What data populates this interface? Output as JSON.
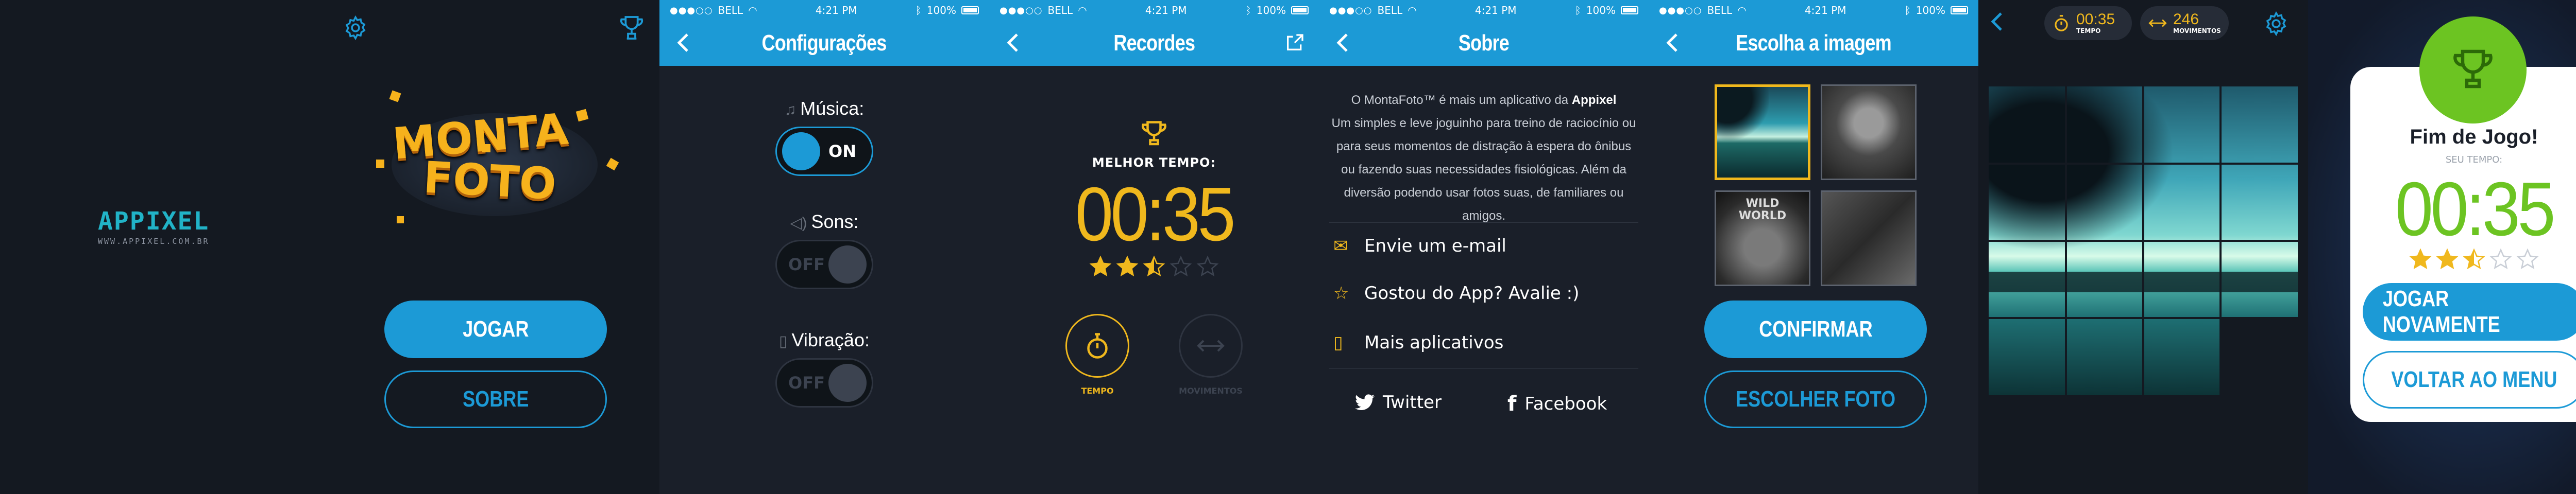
{
  "status_bar": {
    "carrier": "BELL",
    "time": "4:21 PM",
    "battery": "100%",
    "dots": "●●●○○"
  },
  "home": {
    "logo_brand": "APPIXEL",
    "logo_url": "WWW.APPIXEL.COM.BR",
    "game_logo_line1": "MONTA",
    "game_logo_line2": "FOTO",
    "play_label": "JOGAR",
    "about_label": "SOBRE"
  },
  "settings": {
    "title": "Configurações",
    "music_label": "Música:",
    "music_state": "ON",
    "sounds_label": "Sons:",
    "sounds_state": "OFF",
    "vibration_label": "Vibração:",
    "vibration_state": "OFF"
  },
  "records": {
    "title": "Recordes",
    "best_time_label": "MELHOR TEMPO:",
    "best_time": "00:35",
    "stars_filled": 2.5,
    "stars_total": 5,
    "tab_time": "TEMPO",
    "tab_moves": "MOVIMENTOS"
  },
  "about": {
    "title": "Sobre",
    "text_prefix": "O MontaFoto™ é mais um aplicativo da ",
    "text_brand": "Appixel",
    "text_body": "Um simples e leve joguinho para treino de raciocínio ou para seus momentos de distração à espera do ônibus ou fazendo suas necessidades fisiológicas. Além da diversão podendo usar fotos suas, de familiares ou amigos.",
    "email_label": "Envie um e-mail",
    "rate_label": "Gostou do App? Avalie :)",
    "more_label": "Mais aplicativos",
    "twitter_label": "Twitter",
    "facebook_label": "Facebook"
  },
  "choose": {
    "title": "Escolha a imagem",
    "thumb_wild_text_1": "WILD",
    "thumb_wild_text_2": "WORLD",
    "confirm_label": "CONFIRMAR",
    "choose_photo_label": "ESCOLHER FOTO"
  },
  "game": {
    "time": "00:35",
    "time_label": "TEMPO",
    "moves": "246",
    "moves_label": "MOVIMENTOS"
  },
  "game_over": {
    "title": "Fim de Jogo!",
    "your_time_label": "SEU TEMPO:",
    "time": "00:35",
    "stars_filled": 2.5,
    "stars_total": 5,
    "play_again_label": "JOGAR NOVAMENTE",
    "menu_label": "VOLTAR AO MENU"
  },
  "colors": {
    "accent": "#1c9ad6",
    "gold": "#f0b81d",
    "bg": "#1a1f29",
    "green": "#6cc422"
  }
}
